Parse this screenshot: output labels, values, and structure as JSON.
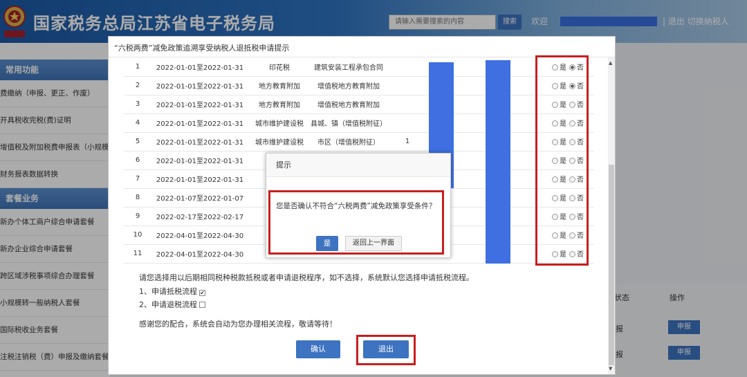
{
  "header": {
    "title": "国家税务总局江苏省电子税务局",
    "search_placeholder": "请输入需要搜索的内容",
    "search_button": "搜索",
    "welcome": "欢迎",
    "logout": "| 退出",
    "switch_taxpayer": "切换纳税人"
  },
  "sidebar": {
    "section1": "常用功能",
    "section1_items": [
      "费缴纳（申报、更正、作废）",
      "开具税收完税(费)证明",
      "增值税及附加税费申报表（小规模纳税人适用）",
      "财务报表数据转换"
    ],
    "section2": "套餐业务",
    "section2_items": [
      "新办个体工商户综合申请套餐",
      "新办企业综合申请套餐",
      "跨区域涉税事项综合办理套餐",
      "小规模转一般纳税人套餐",
      "国际税收业务套餐",
      "注税注销税（费）申报及缴纳套餐"
    ]
  },
  "background_table": {
    "col_status": "状态",
    "col_action": "操作",
    "status_1": "报",
    "status_2": "报",
    "action_label": "申报"
  },
  "modal": {
    "title": "“六税两费”减免政策追溯享受纳税人退抵税申请提示",
    "radio_yes": "是",
    "radio_no": "否",
    "rows": [
      {
        "no": "1",
        "period": "2022-01-01至2022-01-31",
        "tax": "印花税",
        "item": "建筑安装工程承包合同",
        "c": "",
        "choice": "no"
      },
      {
        "no": "2",
        "period": "2022-01-01至2022-01-31",
        "tax": "地方教育附加",
        "item": "增值税地方教育附加",
        "c": "",
        "choice": "no"
      },
      {
        "no": "3",
        "period": "2022-01-01至2022-01-31",
        "tax": "地方教育附加",
        "item": "增值税地方教育附加",
        "c": "",
        "choice": ""
      },
      {
        "no": "4",
        "period": "2022-01-01至2022-01-31",
        "tax": "城市维护建设税",
        "item": "县城、镇（增值税附征）",
        "c": "",
        "choice": ""
      },
      {
        "no": "5",
        "period": "2022-01-01至2022-01-31",
        "tax": "城市维护建设税",
        "item": "市区（增值税附征）",
        "c": "1",
        "choice": ""
      },
      {
        "no": "6",
        "period": "2022-01-01至2022-01-31",
        "tax": "",
        "item": "",
        "c": "",
        "choice": ""
      },
      {
        "no": "7",
        "period": "2022-01-01至2022-01-31",
        "tax": "",
        "item": "",
        "c": "",
        "choice": ""
      },
      {
        "no": "8",
        "period": "2022-01-07至2022-01-07",
        "tax": "",
        "item": "",
        "c": "",
        "choice": ""
      },
      {
        "no": "9",
        "period": "2022-02-17至2022-02-17",
        "tax": "",
        "item": "",
        "c": "",
        "choice": ""
      },
      {
        "no": "10",
        "period": "2022-04-01至2022-04-30",
        "tax": "",
        "item": "",
        "c": "",
        "choice": ""
      },
      {
        "no": "11",
        "period": "2022-04-01至2022-04-30",
        "tax": "",
        "item": "",
        "c": "",
        "choice": ""
      }
    ],
    "note_line1": "请您选择用以后期相同税种税款抵税或者申请退税程序，如不选择，系统默认您选择申请抵税流程。",
    "option1": "1、申请抵税流程",
    "option2": "2、申请退税流程",
    "note_line2": "感谢您的配合，系统会自动为您办理相关流程，敬请等待！",
    "confirm_button": "确认",
    "exit_button": "退出"
  },
  "dialog": {
    "title": "提示",
    "message": "您是否确认不符合“六税两费”减免政策享受条件？",
    "yes_button": "是",
    "back_button": "返回上一界面"
  },
  "colors": {
    "accent": "#3d73c0",
    "highlight": "#c81e1e",
    "mask": "#3f6fe0"
  }
}
